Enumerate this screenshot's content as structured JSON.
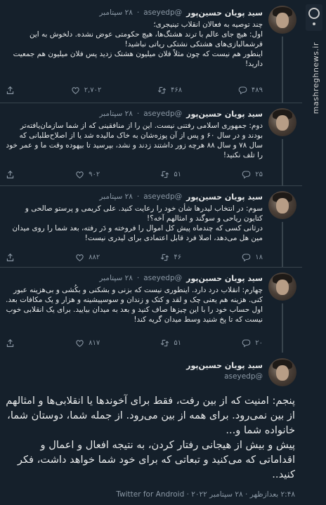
{
  "watermark": {
    "text": "mashreghnews.ir",
    "logo_icon": "mashregh-logo-icon"
  },
  "tweets": [
    {
      "name": "سید پویان حسین‌پور",
      "handle": "@aseyedp",
      "time": "۲۸ سپتامبر",
      "text": "چند توصیه به فعالان انقلاب تینیجری؛\nاول: هیچ جای عالم با ترند هشتگ‌ها، هیچ حکومتی عوض نشده. دلخوش به این قرشمالبازی‌های هشتکی نشتکی ریاتی نباشید!\nاینطور هم نیست که چون مثلاً فلان میلیون هشتک زدید پس فلان میلیون هم جمعیت دارید!",
      "replies": "۲,۷۰۲",
      "retweets": "۴۶۸",
      "likes": "۴۸۹"
    },
    {
      "name": "سید پویان حسین‌پور",
      "handle": "@aseyedp",
      "time": "۲۸ سپتامبر",
      "text": "دوم: جمهوری اسلامی رفتنی نیست. این را از منافقینی که از شما سازمان‌یافته‌تر بودند و در سال ۶۰ و پس از آن پوزه‌شان به خاک مالیده شد یا از اصلاح‌طلبانی که سال ۷۸ و سال ۸۸ هرچه زور داشتند زدند و نشد، بپرسید تا بیهوده وقت ما و عمر خود را تلف نکنید!",
      "replies": "۹۰۲",
      "retweets": "۵۱",
      "likes": "۲۵"
    },
    {
      "name": "سید پویان حسین‌پور",
      "handle": "@aseyedp",
      "time": "۲۸ سپتامبر",
      "text": "سوم: در انتخاب لیدرها شأن خود را رعایت کنید. علی کریمی و پرستو صالحی و کتایون ریاحی و سوگند و امثالهم آخه؟!\nدرثانی کسی که چندماه پیش کل اموال را فروخته و دَر رفته، بعد شما را روی میدان مین هل می‌دهد، اصلا فرد قابل اعتمادی برای لیدری نیست!",
      "replies": "۸۸۲",
      "retweets": "۴۶",
      "likes": "۱۸"
    },
    {
      "name": "سید پویان حسین‌پور",
      "handle": "@aseyedp",
      "time": "۲۸ سپتامبر",
      "text": "چهارم: انقلاب درد دارد. اینطوری نیست که بزنی و بشکنی و بکُشی و بی‌هزینه عبور کنی. هزینه هم یعنی چک و لقد و کتک و زندان و سوسپیشینه و هزار و یک مکافات بعد. اول حساب خود را با این چیزها صاف کنید و بعد به میدان بیایید. برای یک انقلابی خوب نیست که تا پخ شنید وسط میدان گریه کند!",
      "replies": "۸۱۷",
      "retweets": "۵۱",
      "likes": "۲۰"
    }
  ],
  "final_tweet": {
    "name": "سید پویان حسین‌پور",
    "handle": "@aseyedp",
    "text": "پنجم: امنیت که از بین رفت، فقط برای آخوندها یا انقلابی‌ها و امثالهم از بین نمی‌رود. برای همه از بین می‌رود. از جمله شما، دوستان شما، خانواده شما و...\nپیش و بیش از هیجانی رفتار کردن، به نتیجه افعال و اعمال و اقداماتی که می‌کنید و تبعاتی که برای خود شما خواهد داشت، فکر کنید..",
    "meta": "۲:۴۸ بعدازظهر · ۲۸ سپتامبر ۲۰۲۲ · Twitter for Android"
  }
}
